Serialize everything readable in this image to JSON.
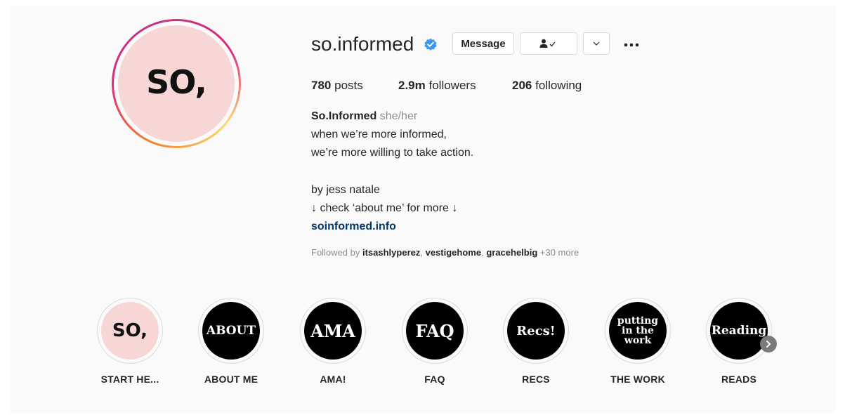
{
  "profile": {
    "avatar_text": "SO,",
    "username": "so.informed",
    "verified": true,
    "colors": {
      "verified": "#3897f0",
      "link": "#00376b",
      "avatar_bg": "#f7d6d6"
    }
  },
  "actions": {
    "message_label": "Message",
    "following_icon": "person-check-icon",
    "dropdown_icon": "chevron-down-icon",
    "more_icon": "more-options-icon"
  },
  "stats": {
    "posts_count": "780",
    "posts_label": "posts",
    "followers_count": "2.9m",
    "followers_label": "followers",
    "following_count": "206",
    "following_label": "following"
  },
  "bio": {
    "name": "So.Informed",
    "pronouns": "she/her",
    "line1": "when we’re more informed,",
    "line2": "we’re more willing to take action.",
    "line3": "by jess natale",
    "line4": "↓ check ‘about me’ for more ↓",
    "link": "soinformed.info"
  },
  "followed_by": {
    "prefix": "Followed by ",
    "user1": "itsashlyperez",
    "sep1": ", ",
    "user2": "vestigehome",
    "sep2": ", ",
    "user3": "gracehelbig",
    "suffix": " +30 more"
  },
  "highlights": [
    {
      "cover": "SO,",
      "label": "START HE..."
    },
    {
      "cover": "ABOUT",
      "label": "ABOUT ME"
    },
    {
      "cover": "AMA",
      "label": "AMA!"
    },
    {
      "cover": "FAQ",
      "label": "FAQ"
    },
    {
      "cover": "Recs!",
      "label": "RECS"
    },
    {
      "cover": "putting in the work",
      "label": "THE WORK"
    },
    {
      "cover": "Reading",
      "label": "READS"
    }
  ]
}
